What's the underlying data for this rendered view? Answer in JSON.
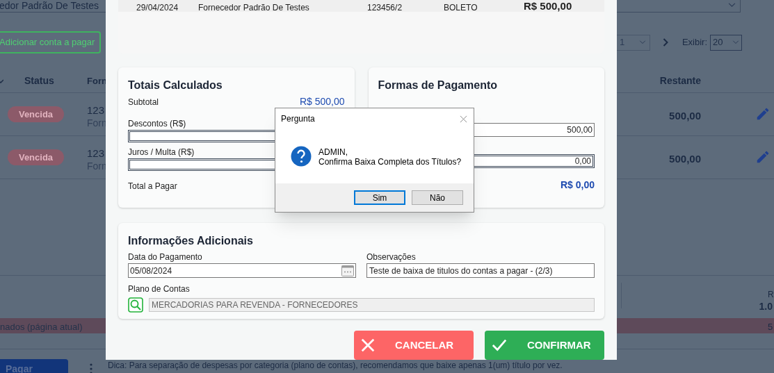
{
  "background": {
    "supplier_filter": "edor Padrão De Testes",
    "add_button": "Adicionar conta a pagar",
    "pagination": {
      "page": "1",
      "show_label": "Exibir:",
      "page_size": "20"
    },
    "table": {
      "columns": [
        "Status",
        "Forn",
        "Restante"
      ],
      "rows": [
        {
          "status": "Vencida",
          "line_1": "123",
          "line_2": "Forn",
          "remaining": "500,00"
        },
        {
          "status": "Vencida",
          "line_1": "123",
          "line_2": "Forn",
          "remaining": "500,00"
        }
      ]
    },
    "summary": {
      "label": "R",
      "value": "1.0"
    },
    "selected_total": {
      "label": "nados (página atual)",
      "value": "5"
    },
    "pay_button": "Pagar",
    "tip": "Dica: Para separação de despesas por categoria (plano de contas), recomendamos que baixe apenas 1(um) título por vez."
  },
  "modal": {
    "title_row": {
      "date": "29/04/2024",
      "supplier": "Fornecedor Padrão De Testes",
      "document": "123456/2",
      "method": "BOLETO",
      "amount": "R$ 500,00"
    },
    "totals": {
      "title": "Totais Calculados",
      "subtotal_label": "Subtotal",
      "subtotal": "R$ 500,00",
      "discount_label": "Descontos (R$)",
      "interest_label": "Juros / Multa (R$)",
      "total_label": "Total a Pagar"
    },
    "payment": {
      "title": "Formas de Pagamento",
      "amount": "500,00",
      "change": "0,00",
      "remaining": "R$ 0,00"
    },
    "additional": {
      "title": "Informações Adicionais",
      "date_label": "Data do Pagamento",
      "date": "05/08/2024",
      "notes_label": "Observações",
      "notes": "Teste de baixa de titulos do contas a pagar - (2/3)",
      "account_label": "Plano de Contas",
      "account": "MERCADORIAS PARA REVENDA - FORNECEDORES"
    },
    "buttons": [
      {
        "kind": "cancel",
        "label": "CANCELAR"
      },
      {
        "kind": "confirm",
        "label": "CONFIRMAR"
      }
    ]
  },
  "dialog": {
    "title": "Pergunta",
    "message": [
      "ADMIN,",
      "Confirma Baixa Completa dos Títulos?"
    ],
    "buttons": [
      {
        "label": "Sim",
        "selected": true
      },
      {
        "label": "Não",
        "selected": false
      }
    ]
  }
}
